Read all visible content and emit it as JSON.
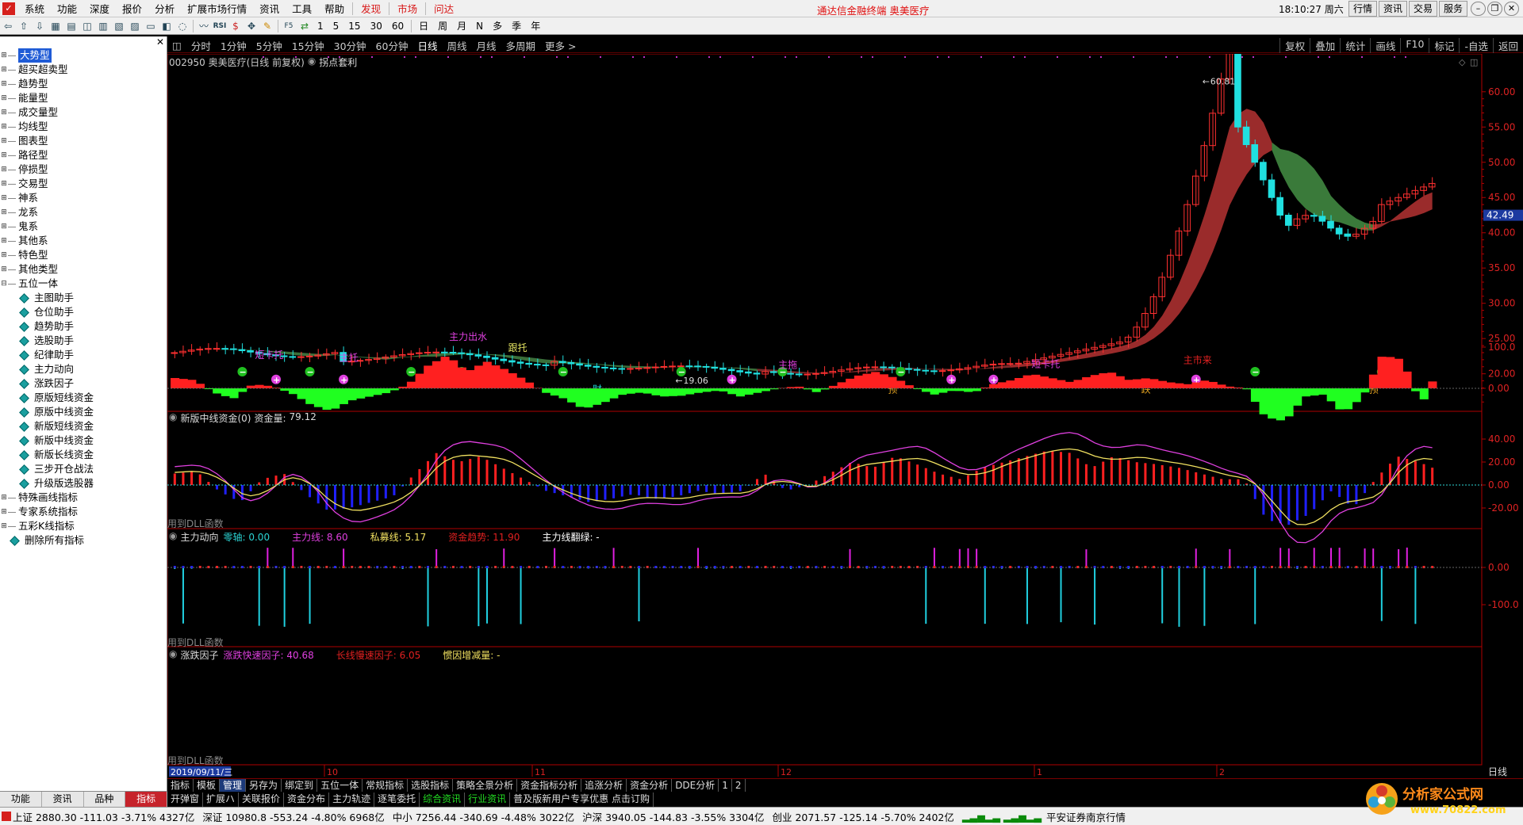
{
  "menubar": {
    "items": [
      "系统",
      "功能",
      "深度",
      "报价",
      "分析",
      "扩展市场行情",
      "资讯",
      "工具",
      "帮助"
    ],
    "red_items": [
      "发现",
      "市场",
      "问达"
    ],
    "ad": "通达信金融终端  奥美医疗",
    "clock": "18:10:27 周六",
    "right_buttons": [
      "行情",
      "资讯",
      "交易",
      "服务"
    ]
  },
  "toolbar": {
    "periods": [
      "1",
      "5",
      "15",
      "30",
      "60",
      "日",
      "周",
      "月",
      "N",
      "多",
      "季",
      "年"
    ]
  },
  "left_panel": {
    "tree": [
      {
        "label": "大势型",
        "type": "root",
        "selected": true
      },
      {
        "label": "超买超卖型",
        "type": "root"
      },
      {
        "label": "趋势型",
        "type": "root"
      },
      {
        "label": "能量型",
        "type": "root"
      },
      {
        "label": "成交量型",
        "type": "root"
      },
      {
        "label": "均线型",
        "type": "root"
      },
      {
        "label": "图表型",
        "type": "root"
      },
      {
        "label": "路径型",
        "type": "root"
      },
      {
        "label": "停损型",
        "type": "root"
      },
      {
        "label": "交易型",
        "type": "root"
      },
      {
        "label": "神系",
        "type": "root"
      },
      {
        "label": "龙系",
        "type": "root"
      },
      {
        "label": "鬼系",
        "type": "root"
      },
      {
        "label": "其他系",
        "type": "root"
      },
      {
        "label": "特色型",
        "type": "root"
      },
      {
        "label": "其他类型",
        "type": "root"
      },
      {
        "label": "五位一体",
        "type": "open"
      },
      {
        "label": "主图助手",
        "type": "child"
      },
      {
        "label": "仓位助手",
        "type": "child"
      },
      {
        "label": "趋势助手",
        "type": "child"
      },
      {
        "label": "选股助手",
        "type": "child"
      },
      {
        "label": "纪律助手",
        "type": "child"
      },
      {
        "label": "主力动向",
        "type": "child"
      },
      {
        "label": "涨跌因子",
        "type": "child"
      },
      {
        "label": "原版短线资金",
        "type": "child"
      },
      {
        "label": "原版中线资金",
        "type": "child"
      },
      {
        "label": "新版短线资金",
        "type": "child"
      },
      {
        "label": "新版中线资金",
        "type": "child"
      },
      {
        "label": "新版长线资金",
        "type": "child"
      },
      {
        "label": "三步开仓战法",
        "type": "child"
      },
      {
        "label": "升级版选股器",
        "type": "child"
      },
      {
        "label": "特殊画线指标",
        "type": "root"
      },
      {
        "label": "专家系统指标",
        "type": "root"
      },
      {
        "label": "五彩K线指标",
        "type": "root"
      },
      {
        "label": "删除所有指标",
        "type": "leaf"
      }
    ],
    "tabs": [
      "功能",
      "资讯",
      "品种",
      "指标"
    ],
    "active_tab": "指标"
  },
  "periodbar": {
    "items": [
      "分时",
      "1分钟",
      "5分钟",
      "15分钟",
      "30分钟",
      "60分钟",
      "日线",
      "周线",
      "月线",
      "多周期",
      "更多 >"
    ],
    "active": "日线",
    "right": [
      "复权",
      "叠加",
      "统计",
      "画线",
      "F10",
      "标记",
      "-自选",
      "返回"
    ]
  },
  "main": {
    "title": "002950 奥美医疗(日线 前复权)",
    "indicator": "拐点套利",
    "high_label": "60.81",
    "low_label": "19.06",
    "price_tag": "42.49",
    "y_ticks": [
      "60.00",
      "55.00",
      "50.00",
      "45.00",
      "40.00",
      "35.00",
      "30.00",
      "25.00",
      "20.00"
    ],
    "annotations": [
      "短卡托",
      "主托",
      "主力出水",
      "跟托",
      "主拖",
      "短卡托",
      "主市来",
      "财",
      "预",
      "跌",
      "预"
    ]
  },
  "pane1": {
    "name": "新版中线资金(0)",
    "label": "资金量:",
    "value": "79.12",
    "foot": "用到DLL函数",
    "y_ticks": [
      "100.0",
      "0.00"
    ]
  },
  "pane2": {
    "name": "主力动向",
    "items": [
      {
        "t": "零轴: 0.00",
        "c": "#2bd4d4"
      },
      {
        "t": "主力线: 8.60",
        "c": "#e040e0"
      },
      {
        "t": "私募线: 5.17",
        "c": "#f0e060"
      },
      {
        "t": "资金趋势: 11.90",
        "c": "#e02020"
      },
      {
        "t": "主力线翻绿: -",
        "c": "#ffffff"
      }
    ],
    "foot": "用到DLL函数",
    "y_ticks": [
      "40.00",
      "20.00",
      "0.00",
      "-20.00"
    ]
  },
  "pane3": {
    "name": "涨跌因子",
    "items": [
      {
        "t": "涨跌快速因子: 40.68",
        "c": "#e040e0"
      },
      {
        "t": "长线慢速因子: 6.05",
        "c": "#e02020"
      },
      {
        "t": "惯因增减量: -",
        "c": "#f0e060"
      }
    ],
    "foot": "用到DLL函数",
    "y_ticks": [
      "0.00",
      "-100.0"
    ]
  },
  "xaxis": {
    "date_box": "2019/09/11/三",
    "months": [
      "10",
      "11",
      "12",
      "1",
      "2"
    ],
    "right_label": "日线"
  },
  "bottom_tabs1": [
    "指标",
    "模板",
    "管理",
    "另存为",
    "绑定到",
    "五位一体",
    "常规指标",
    "选股指标",
    "策略全景分析",
    "资金指标分析",
    "追涨分析",
    "资金分析",
    "DDE分析",
    "1",
    "2"
  ],
  "bottom_tabs1_active": "管理",
  "bottom_tabs2": [
    "开弹窗",
    "扩展ハ",
    "关联报价",
    "资金分布",
    "主力轨迹",
    "逐笔委托",
    "综合资讯",
    "行业资讯",
    "普及版新用户专享优惠 点击订购"
  ],
  "ticker": [
    "上证 2880.30 -111.03 -3.71% 4327亿",
    "深证 10980.8 -553.24 -4.80% 6968亿",
    "中小 7256.44 -340.69 -4.48% 3022亿",
    "沪深 3940.05 -144.83 -3.55% 3304亿",
    "创业 2071.57 -125.14 -5.70% 2402亿"
  ],
  "ticker_broker": "平安证券南京行情",
  "brand": {
    "name": "分析家公式网",
    "url": "www.70822.com"
  },
  "colors": {
    "up": "#ff3030",
    "down": "#20e0e0",
    "ma": "#9a2b2b",
    "fill_green": "#3a7a3a",
    "axis": "#b00000"
  }
}
